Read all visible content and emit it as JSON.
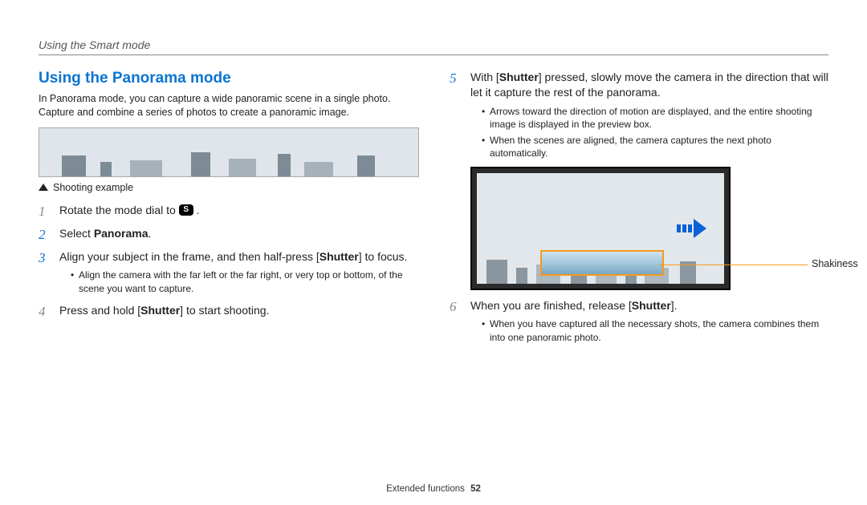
{
  "header": {
    "running_head": "Using the Smart mode"
  },
  "left": {
    "title": "Using the Panorama mode",
    "intro": "In Panorama mode, you can capture a wide panoramic scene in a single photo. Capture and combine a series of photos to create a panoramic image.",
    "caption": "Shooting example",
    "steps": {
      "s1": {
        "num": "1",
        "pre": "Rotate the mode dial to ",
        "icon": "S",
        "post": " ."
      },
      "s2": {
        "num": "2",
        "pre": "Select ",
        "bold": "Panorama",
        "post": "."
      },
      "s3": {
        "num": "3",
        "pre": "Align your subject in the frame, and then half-press [",
        "bold": "Shutter",
        "post": "] to focus.",
        "sub1": "Align the camera with the far left or the far right, or very top or bottom, of the scene you want to capture."
      },
      "s4": {
        "num": "4",
        "pre": "Press and hold [",
        "bold": "Shutter",
        "post": "] to start shooting."
      }
    }
  },
  "right": {
    "steps": {
      "s5": {
        "num": "5",
        "pre": "With [",
        "bold": "Shutter",
        "post": "] pressed, slowly move the camera in the direction that will let it capture the rest of the panorama.",
        "sub1": "Arrows toward the direction of motion are displayed, and the entire shooting image is displayed in the preview box.",
        "sub2": "When the scenes are aligned, the camera captures the next photo automatically."
      },
      "s6": {
        "num": "6",
        "pre": "When you are finished, release [",
        "bold": "Shutter",
        "post": "].",
        "sub1": "When you have captured all the necessary shots, the camera combines them into one panoramic photo."
      }
    },
    "shakiness_label": "Shakiness"
  },
  "footer": {
    "section": "Extended functions",
    "page": "52"
  }
}
